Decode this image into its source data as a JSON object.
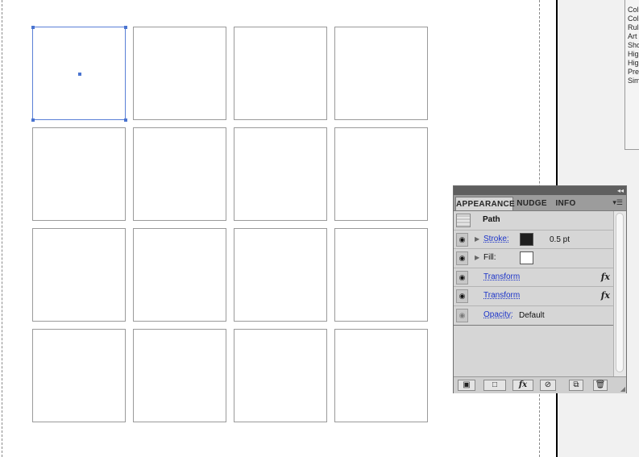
{
  "side_menu": {
    "items": [
      "Col",
      "Col",
      "Rul",
      "Art",
      "Sho",
      "Hig",
      "Hig",
      "Pre",
      "Sim"
    ]
  },
  "appearance_panel": {
    "tabs": [
      {
        "label": "APPEARANCE",
        "active": true
      },
      {
        "label": "NUDGE",
        "active": false
      },
      {
        "label": "INFO",
        "active": false
      }
    ],
    "path_label": "Path",
    "stroke": {
      "label": "Stroke:",
      "weight": "0.5 pt",
      "color": "#1f1f1f"
    },
    "fill": {
      "label": "Fill:",
      "color": "#ffffff"
    },
    "effects": [
      {
        "label": "Transform"
      },
      {
        "label": "Transform"
      }
    ],
    "opacity": {
      "label": "Opacity:",
      "value": "Default"
    },
    "bottom_buttons": [
      "add-new-stroke",
      "add-new-fill",
      "add-new-effect",
      "clear-appearance",
      "duplicate-item",
      "delete-item"
    ]
  },
  "canvas": {
    "grid_rows": 4,
    "grid_cols": 4,
    "selected_cell": 0,
    "selection_color": "#4a74d0"
  }
}
